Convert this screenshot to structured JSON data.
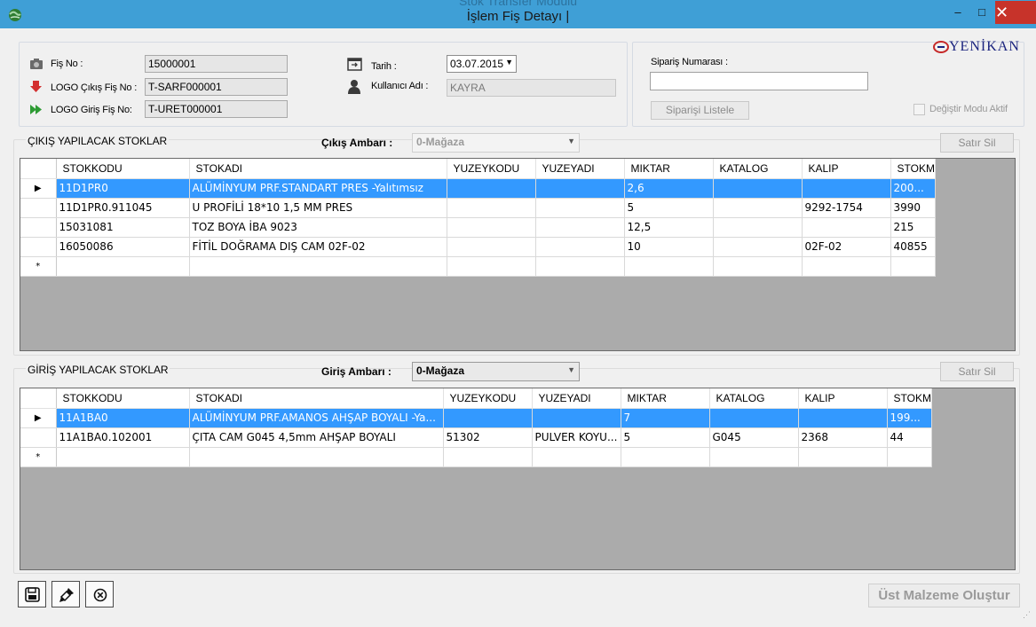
{
  "window": {
    "ghost_title": "Stok Transfer Modulu",
    "title": "İşlem Fiş Detayı |",
    "minimize": "–",
    "maximize": "□",
    "close": "✕"
  },
  "header": {
    "fis_no_label": "Fiş No :",
    "fis_no_value": "15000001",
    "logo_cikis_label": "LOGO Çıkış Fiş No :",
    "logo_cikis_value": "T-SARF000001",
    "logo_giris_label": "LOGO Giriş Fiş No:",
    "logo_giris_value": "T-URET000001",
    "tarih_label": "Tarih :",
    "tarih_value": "03.07.2015",
    "kullanici_label": "Kullanıcı Adı :",
    "kullanici_value": "KAYRA"
  },
  "order": {
    "siparis_label": "Sipariş Numarası :",
    "siparis_value": "",
    "listele_button": "Siparişi Listele",
    "degistir_label": "Değiştir Modu Aktif",
    "logo_text": "YENİKAN"
  },
  "cikis": {
    "title": "ÇIKIŞ YAPILACAK STOKLAR",
    "ambar_label": "Çıkış Ambarı :",
    "ambar_value": "0-Mağaza",
    "satir_sil": "Satır Sil",
    "columns": [
      "STOKKODU",
      "STOKADI",
      "YUZEYKODU",
      "YUZEYADI",
      "MIKTAR",
      "KATALOG",
      "KALIP",
      "STOKM"
    ],
    "rows": [
      {
        "indicator": "▶",
        "cells": [
          "11D1PR0",
          "ALÜMİNYUM PRF.STANDART PRES  -Yalıtımsız",
          "",
          "",
          "2,6",
          "",
          "",
          "200..."
        ]
      },
      {
        "indicator": "",
        "cells": [
          "11D1PR0.911045",
          "U PROFİLİ 18*10 1,5 MM PRES",
          "",
          "",
          "5",
          "",
          "9292-1754",
          "3990"
        ]
      },
      {
        "indicator": "",
        "cells": [
          "15031081",
          "TOZ BOYA İBA 9023",
          "",
          "",
          "12,5",
          "",
          "",
          "215"
        ]
      },
      {
        "indicator": "",
        "cells": [
          "16050086",
          "FİTİL DOĞRAMA DIŞ CAM 02F-02",
          "",
          "",
          "10",
          "",
          "02F-02",
          "40855"
        ]
      },
      {
        "indicator": "*",
        "cells": [
          "",
          "",
          "",
          "",
          "",
          "",
          "",
          ""
        ]
      }
    ]
  },
  "giris": {
    "title": "GİRİŞ YAPILACAK STOKLAR",
    "ambar_label": "Giriş Ambarı :",
    "ambar_value": "0-Mağaza",
    "satir_sil": "Satır Sil",
    "columns": [
      "STOKKODU",
      "STOKADI",
      "YUZEYKODU",
      "YUZEYADI",
      "MIKTAR",
      "KATALOG",
      "KALIP",
      "STOKM"
    ],
    "rows": [
      {
        "indicator": "▶",
        "cells": [
          "11A1BA0",
          "ALÜMİNYUM PRF.AMANOS AHŞAP BOYALI  -Ya...",
          "",
          "",
          "7",
          "",
          "",
          "199..."
        ]
      },
      {
        "indicator": "",
        "cells": [
          "11A1BA0.102001",
          "ÇITA CAM G045 4,5mm AHŞAP BOYALI",
          "51302",
          "PULVER KOYU...",
          "5",
          "G045",
          "2368",
          "44"
        ]
      },
      {
        "indicator": "*",
        "cells": [
          "",
          "",
          "",
          "",
          "",
          "",
          "",
          ""
        ]
      }
    ]
  },
  "footer": {
    "ust_malzeme_button": "Üst Malzeme Oluştur"
  },
  "icons": {
    "app": "globe-icon",
    "fis_no": "camera-icon",
    "logo_cikis": "red-down-arrow-icon",
    "logo_giris": "green-forward-icon",
    "tarih": "calendar-icon",
    "kullanici": "user-icon",
    "save": "save-icon",
    "clear": "brush-icon",
    "cancel": "close-circle-icon"
  },
  "colors": {
    "titlebar": "#3f9fd6",
    "selection": "#3399ff",
    "close_button": "#c7332a",
    "grid_background": "#ababab"
  }
}
